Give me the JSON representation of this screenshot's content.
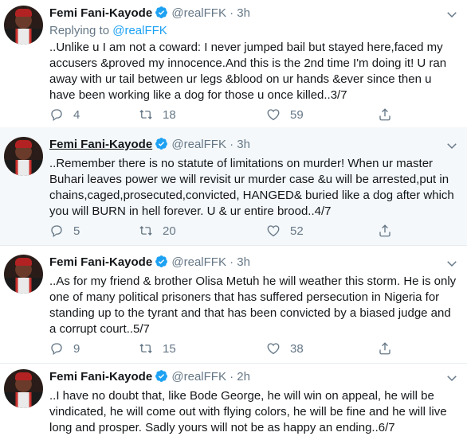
{
  "tweets": [
    {
      "name": "Femi Fani-Kayode",
      "handle": "@realFFK",
      "dot": "·",
      "time": "3h",
      "reply_prefix": "Replying to ",
      "reply_handle": "@realFFK",
      "text": "..Unlike u I am not a coward: I never jumped bail but stayed here,faced my accusers &proved my innocence.And this is the 2nd time I'm doing it! U ran away with ur tail between ur legs &blood on ur hands &ever since then u have been working like a dog for those u once killed..3/7",
      "replies": "4",
      "retweets": "18",
      "likes": "59"
    },
    {
      "name": "Femi Fani-Kayode",
      "handle": "@realFFK",
      "dot": "·",
      "time": "3h",
      "text": "..Remember there is no statute of limitations on murder! When ur master Buhari leaves power we will revisit ur murder case &u will be arrested,put in chains,caged,prosecuted,convicted, HANGED& buried like a dog after which you will BURN in hell forever. U & ur entire brood..4/7",
      "replies": "5",
      "retweets": "20",
      "likes": "52"
    },
    {
      "name": "Femi Fani-Kayode",
      "handle": "@realFFK",
      "dot": "·",
      "time": "3h",
      "text": "..As for my friend & brother Olisa Metuh he will weather this storm. He is only one of many political prisoners that has suffered persecution in Nigeria for standing up to the tyrant and that has been convicted by a biased judge and a corrupt court..5/7",
      "replies": "9",
      "retweets": "15",
      "likes": "38"
    },
    {
      "name": "Femi Fani-Kayode",
      "handle": "@realFFK",
      "dot": "·",
      "time": "2h",
      "text": "..I have no doubt that, like Bode George, he will win on appeal, he will be vindicated, he will come out with flying colors, he will be fine and he will live long and prosper. Sadly yours will not be as happy an ending..6/7"
    }
  ],
  "colors": {
    "accent": "#1da1f2",
    "secondary_text": "#657786",
    "highlight_bg": "#f5f8fa"
  },
  "icons": [
    "verified-badge-icon",
    "chevron-down-icon",
    "reply-icon",
    "retweet-icon",
    "like-icon",
    "share-icon"
  ]
}
